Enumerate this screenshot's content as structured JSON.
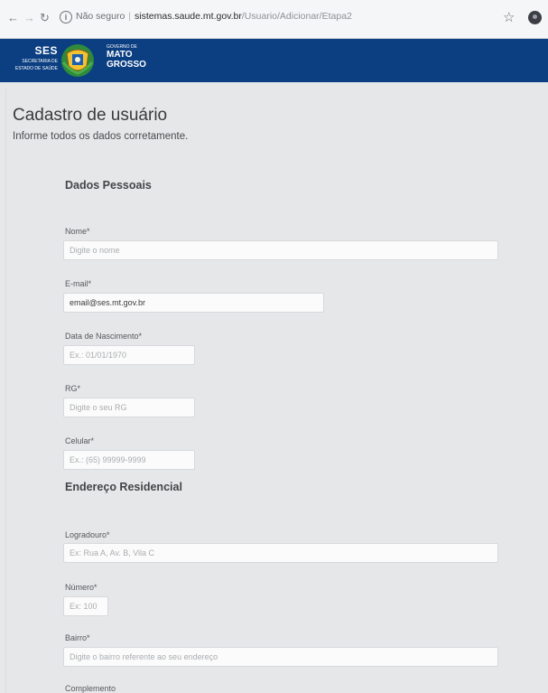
{
  "browser": {
    "security_label": "Não seguro",
    "url_host": "sistemas.saude.mt.gov.br",
    "url_path": "/Usuario/Adicionar/Etapa2"
  },
  "header": {
    "ses_abbr": "SES",
    "ses_name_line1": "SECRETARIA DE",
    "ses_name_line2": "ESTADO DE SAÚDE",
    "gov_line1": "GOVERNO DE",
    "gov_line2": "MATO",
    "gov_line3": "GROSSO"
  },
  "page": {
    "title": "Cadastro de usuário",
    "subtitle": "Informe todos os dados corretamente."
  },
  "sections": {
    "personal": "Dados Pessoais",
    "address": "Endereço Residencial"
  },
  "fields": {
    "nome": {
      "label": "Nome*",
      "placeholder": "Digite o nome",
      "value": ""
    },
    "email": {
      "label": "E-mail*",
      "placeholder": "",
      "value": "email@ses.mt.gov.br"
    },
    "nascimento": {
      "label": "Data de Nascimento*",
      "placeholder": "Ex.: 01/01/1970",
      "value": ""
    },
    "rg": {
      "label": "RG*",
      "placeholder": "Digite o seu RG",
      "value": ""
    },
    "celular": {
      "label": "Celular*",
      "placeholder": "Ex.: (65) 99999-9999",
      "value": ""
    },
    "logradouro": {
      "label": "Logradouro*",
      "placeholder": "Ex: Rua A, Av. B, Vila C",
      "value": ""
    },
    "numero": {
      "label": "Número*",
      "placeholder": "Ex: 100",
      "value": ""
    },
    "bairro": {
      "label": "Bairro*",
      "placeholder": "Digite o bairro referente ao seu endereço",
      "value": ""
    },
    "complemento": {
      "label": "Complemento",
      "placeholder": "",
      "value": ""
    }
  },
  "colors": {
    "header_bg": "#0b3f82",
    "page_bg": "#e6e7e9"
  }
}
